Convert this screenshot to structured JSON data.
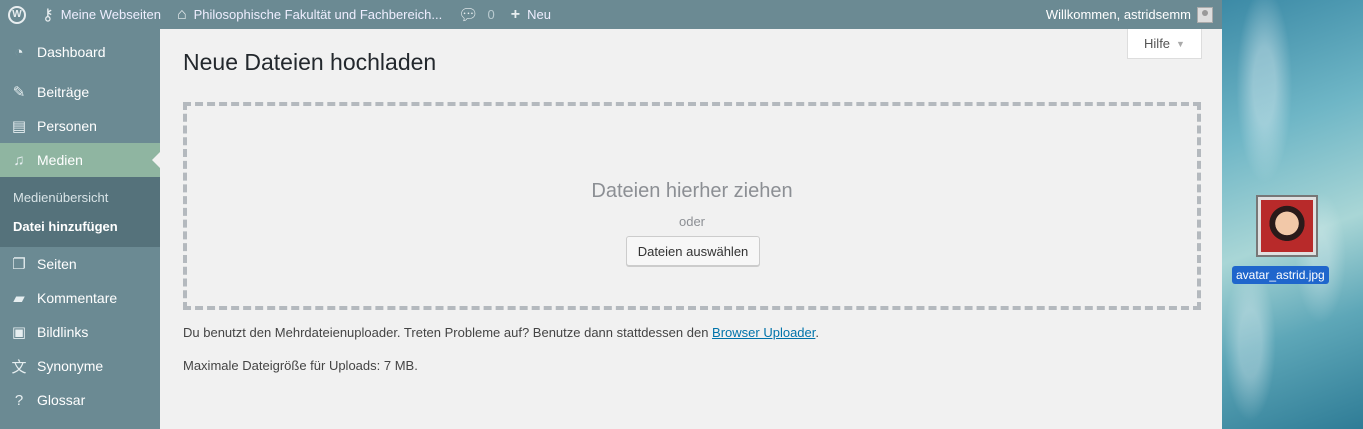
{
  "adminbar": {
    "my_sites": "Meine Webseiten",
    "site_name": "Philosophische Fakultät und Fachbereich...",
    "comments_count": "0",
    "new_label": "Neu",
    "greeting": "Willkommen, astridsemm"
  },
  "sidebar": {
    "items": [
      {
        "label": "Dashboard",
        "icon": "dashboard-icon"
      },
      {
        "label": "Beiträge",
        "icon": "pin-icon"
      },
      {
        "label": "Personen",
        "icon": "id-card-icon"
      },
      {
        "label": "Medien",
        "icon": "media-icon"
      },
      {
        "label": "Seiten",
        "icon": "pages-icon"
      },
      {
        "label": "Kommentare",
        "icon": "comment-icon"
      },
      {
        "label": "Bildlinks",
        "icon": "image-icon"
      },
      {
        "label": "Synonyme",
        "icon": "translate-icon"
      },
      {
        "label": "Glossar",
        "icon": "help-icon"
      }
    ],
    "submenu": [
      "Medienübersicht",
      "Datei hinzufügen"
    ]
  },
  "main": {
    "help_label": "Hilfe",
    "title": "Neue Dateien hochladen",
    "drop_title": "Dateien hierher ziehen",
    "or_label": "oder",
    "select_button": "Dateien auswählen",
    "uploader_text": "Du benutzt den Mehrdateienuploader. Treten Probleme auf? Benutze dann stattdessen den ",
    "browser_uploader_link": "Browser Uploader",
    "uploader_text_end": ".",
    "max_size": "Maximale Dateigröße für Uploads: 7 MB."
  },
  "desktop": {
    "file_label": "avatar_astrid.jpg"
  },
  "colors": {
    "adminbar": "#6b8a93",
    "active_menu": "#8fb5a1",
    "link": "#0073aa"
  }
}
